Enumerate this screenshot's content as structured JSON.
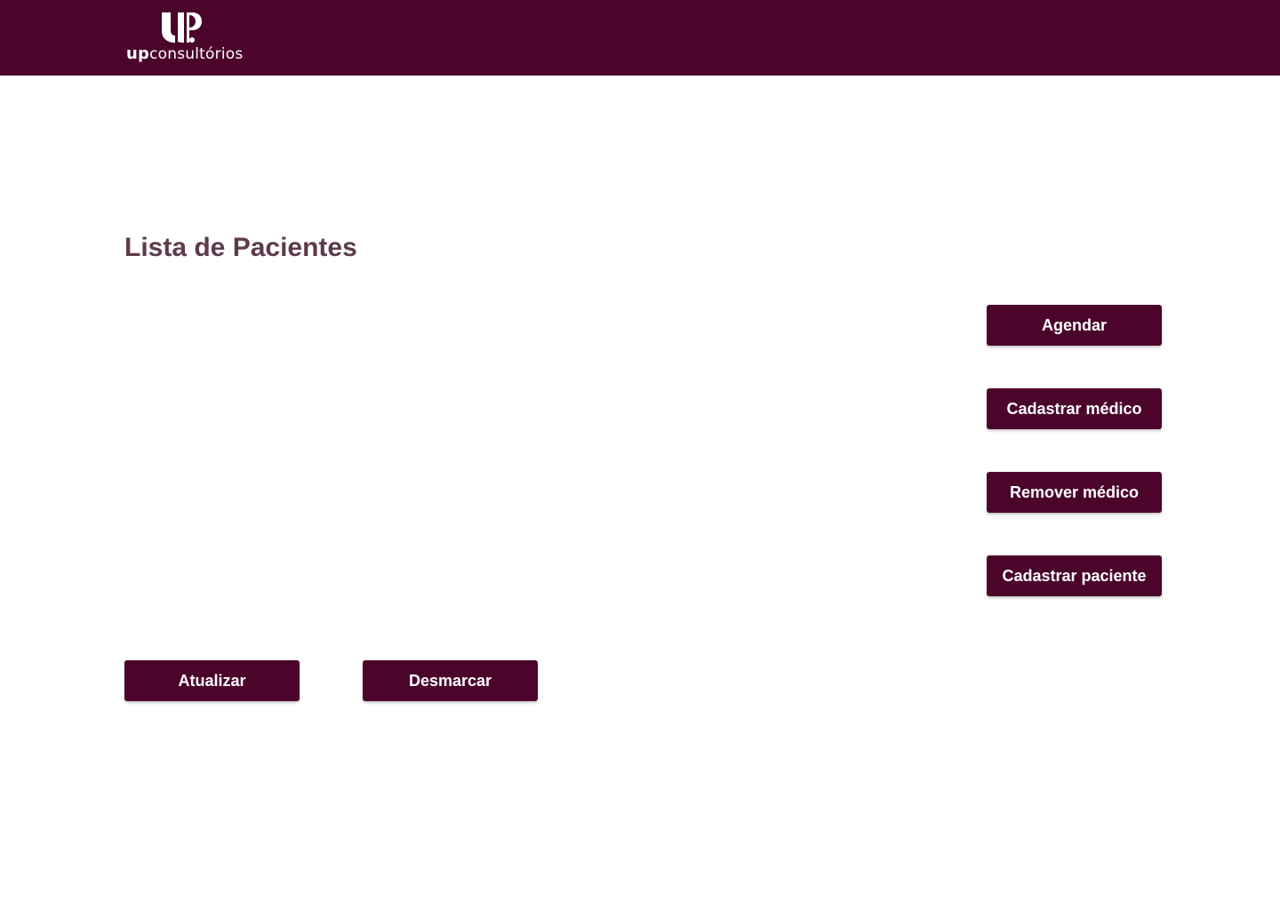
{
  "header": {
    "logo": {
      "prefix": "up",
      "suffix": "consultórios",
      "icon": "up-logo-mark-icon"
    }
  },
  "main": {
    "title": "Lista de Pacientes",
    "patients": []
  },
  "actions": {
    "agendar": "Agendar",
    "cadastrar_medico": "Cadastrar médico",
    "remover_medico": "Remover médico",
    "cadastrar_paciente": "Cadastrar paciente",
    "atualizar": "Atualizar",
    "desmarcar": "Desmarcar"
  },
  "colors": {
    "brand": "#4b052b",
    "title": "#5d3b4c",
    "background": "#ffffff"
  }
}
